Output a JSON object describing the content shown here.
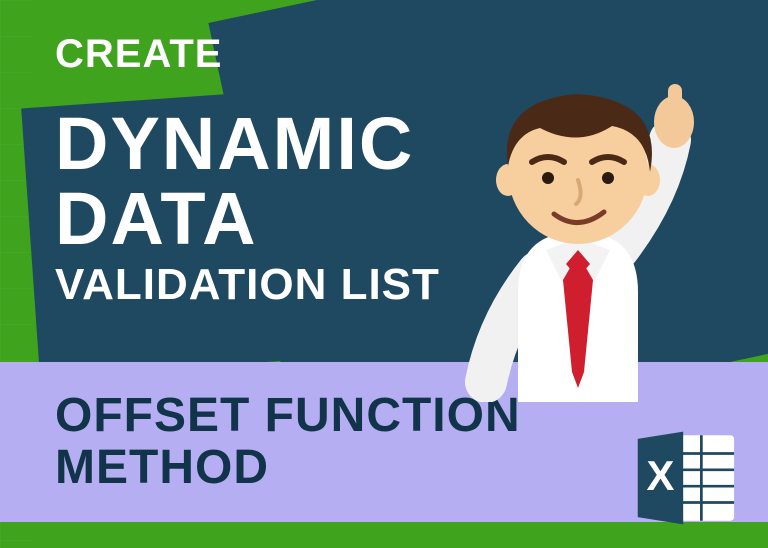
{
  "heading": {
    "create": "CREATE",
    "line1": "DYNAMIC",
    "line2": "DATA",
    "line3": "VALIDATION LIST"
  },
  "band": {
    "line1": "OFFSET FUNCTION",
    "line2": "METHOD"
  },
  "icon": {
    "label": "X"
  },
  "colors": {
    "bg": "#3fa31e",
    "panel": "#1e4961",
    "band": "#b6aef2",
    "text_light": "#ffffff",
    "text_dark": "#11344a"
  }
}
